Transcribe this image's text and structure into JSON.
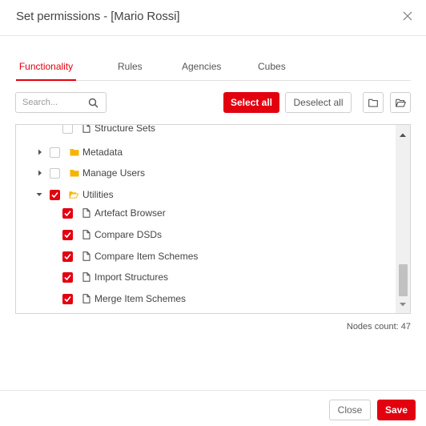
{
  "dialog": {
    "title": "Set permissions - [Mario Rossi]"
  },
  "tabs": [
    {
      "label": "Functionality",
      "active": true
    },
    {
      "label": "Rules",
      "active": false
    },
    {
      "label": "Agencies",
      "active": false
    },
    {
      "label": "Cubes",
      "active": false
    }
  ],
  "toolbar": {
    "search_placeholder": "Search...",
    "search_value": "",
    "select_all_label": "Select all",
    "deselect_all_label": "Deselect all",
    "collapse_icon": "folder-icon",
    "expand_icon": "folder-open-icon"
  },
  "tree": {
    "nodes": [
      {
        "label": "Structure Sets",
        "type": "file",
        "checked": false,
        "expandable": false,
        "expanded": false
      },
      {
        "label": "Metadata",
        "type": "folder",
        "checked": false,
        "expandable": true,
        "expanded": false
      },
      {
        "label": "Manage Users",
        "type": "folder",
        "checked": false,
        "expandable": true,
        "expanded": false
      },
      {
        "label": "Utilities",
        "type": "folder-open",
        "checked": true,
        "expandable": true,
        "expanded": true
      },
      {
        "label": "Artefact Browser",
        "type": "file",
        "checked": true,
        "expandable": false,
        "expanded": false
      },
      {
        "label": "Compare DSDs",
        "type": "file",
        "checked": true,
        "expandable": false,
        "expanded": false
      },
      {
        "label": "Compare Item Schemes",
        "type": "file",
        "checked": true,
        "expandable": false,
        "expanded": false
      },
      {
        "label": "Import Structures",
        "type": "file",
        "checked": true,
        "expandable": false,
        "expanded": false
      },
      {
        "label": "Merge Item Schemes",
        "type": "file",
        "checked": true,
        "expandable": false,
        "expanded": false
      }
    ]
  },
  "status": {
    "nodes_count": "Nodes count: 47"
  },
  "footer": {
    "close_label": "Close",
    "save_label": "Save"
  },
  "colors": {
    "accent": "#e3000f",
    "folder": "#f5b400"
  }
}
